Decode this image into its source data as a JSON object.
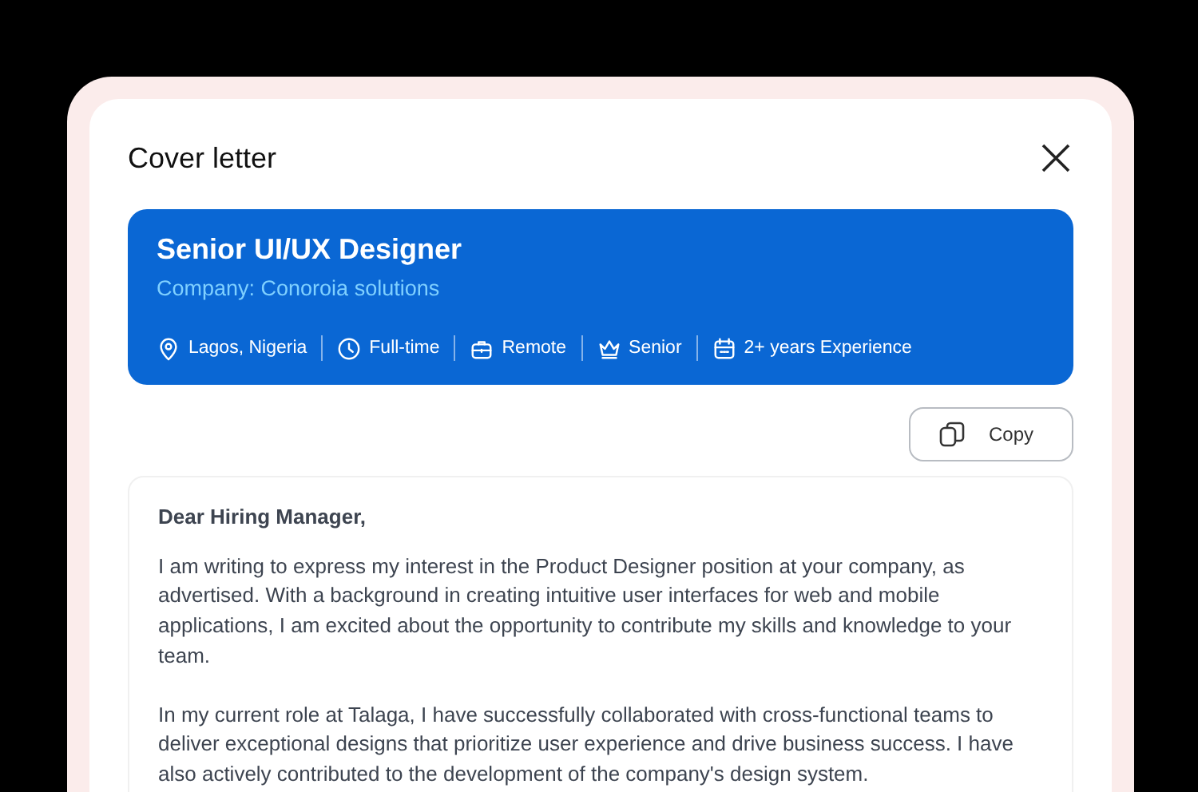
{
  "dialog": {
    "title": "Cover letter"
  },
  "job": {
    "title": "Senior UI/UX Designer",
    "company": "Company: Conoroia solutions",
    "tags": [
      {
        "kind": "location",
        "label": "Lagos, Nigeria"
      },
      {
        "kind": "time",
        "label": "Full-time"
      },
      {
        "kind": "workplace",
        "label": "Remote"
      },
      {
        "kind": "level",
        "label": "Senior"
      },
      {
        "kind": "experience",
        "label": "2+ years Experience"
      }
    ]
  },
  "copy_button": {
    "label": "Copy"
  },
  "letter": {
    "greeting": "Dear Hiring Manager,",
    "paragraphs": [
      "I am writing to express my interest in the Product Designer position at your company, as advertised. With a background in creating intuitive user interfaces for web and mobile applications, I am excited about the opportunity to contribute my skills and knowledge to your team.",
      "In my current role at Talaga, I have successfully collaborated with cross-functional teams to deliver exceptional designs that prioritize user experience and drive business success. I have also actively contributed to the development of the company's design system."
    ]
  }
}
